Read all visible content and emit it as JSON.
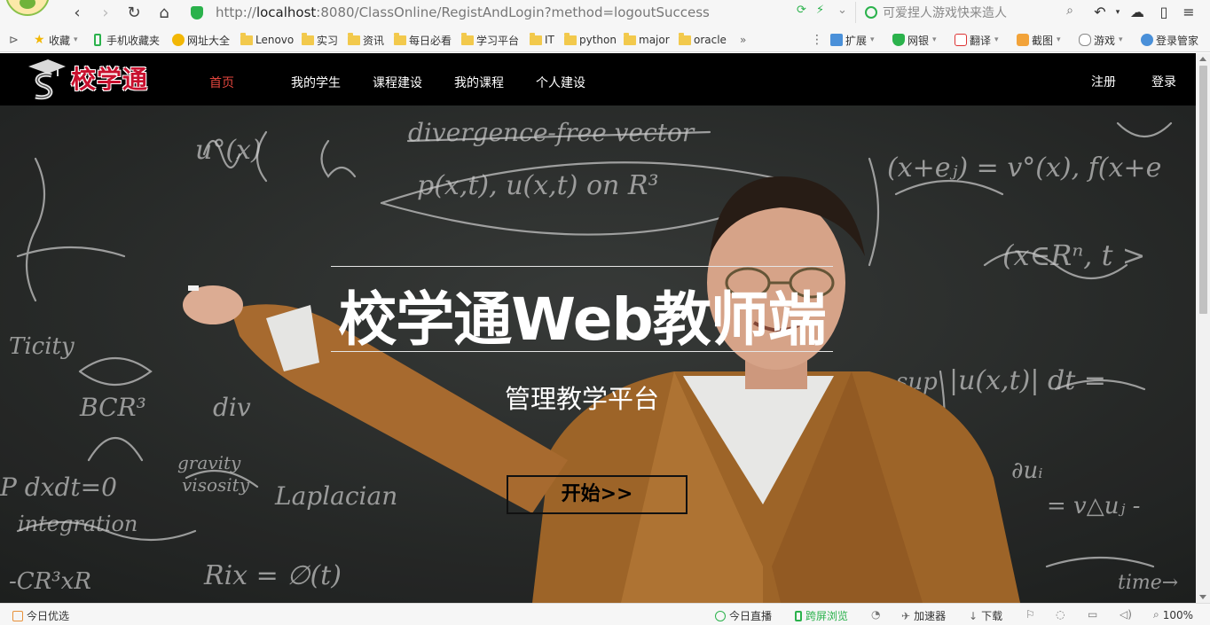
{
  "browser": {
    "url": {
      "scheme": "http://",
      "host": "localhost",
      "rest": ":8080/ClassOnline/RegistAndLogin?method=logoutSuccess"
    },
    "search_placeholder": "可爱捏人游戏快来造人",
    "bookmarks": [
      {
        "label": "收藏",
        "icon": "star-icon"
      },
      {
        "label": "手机收藏夹",
        "icon": "phone-icon"
      },
      {
        "label": "网址大全",
        "icon": "compass-icon"
      },
      {
        "label": "Lenovo",
        "icon": "folder-icon"
      },
      {
        "label": "实习",
        "icon": "folder-icon"
      },
      {
        "label": "资讯",
        "icon": "folder-icon"
      },
      {
        "label": "每日必看",
        "icon": "folder-icon"
      },
      {
        "label": "学习平台",
        "icon": "folder-icon"
      },
      {
        "label": "IT",
        "icon": "folder-icon"
      },
      {
        "label": "python",
        "icon": "folder-icon"
      },
      {
        "label": "major",
        "icon": "folder-icon"
      },
      {
        "label": "oracle",
        "icon": "folder-icon"
      }
    ],
    "bookmarks_more": "»",
    "extensions": [
      {
        "label": "扩展",
        "icon": "puzzle-icon"
      },
      {
        "label": "网银",
        "icon": "shield-money-icon"
      },
      {
        "label": "翻译",
        "icon": "translate-icon"
      },
      {
        "label": "截图",
        "icon": "scissors-icon"
      },
      {
        "label": "游戏",
        "icon": "gamepad-icon"
      },
      {
        "label": "登录管家",
        "icon": "user-key-icon"
      }
    ],
    "status_bar": {
      "left": "今日优选",
      "live": "今日直播",
      "cross_screen": "跨屏浏览",
      "accelerator": "加速器",
      "download": "下载",
      "zoom": "100%"
    },
    "colors": {
      "accent_green": "#2bb24c"
    }
  },
  "site": {
    "logo_text": "校学通",
    "nav": [
      {
        "label": "首页",
        "active": true
      },
      {
        "label": "我的学生",
        "active": false
      },
      {
        "label": "课程建设",
        "active": false
      },
      {
        "label": "我的课程",
        "active": false
      },
      {
        "label": "个人建设",
        "active": false
      }
    ],
    "register_label": "注册",
    "login_label": "登录",
    "hero": {
      "title": "校学通Web教师端",
      "subtitle": "管理教学平台",
      "start_button": "开始>>"
    },
    "colors": {
      "nav_bg": "#000000",
      "active_nav": "#e3463e",
      "logo_red": "#c8102e"
    }
  }
}
